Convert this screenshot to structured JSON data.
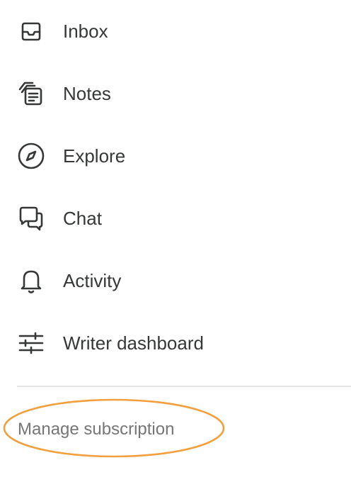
{
  "menu": {
    "items": [
      {
        "label": "Inbox",
        "icon": "inbox-icon"
      },
      {
        "label": "Notes",
        "icon": "notes-icon"
      },
      {
        "label": "Explore",
        "icon": "compass-icon"
      },
      {
        "label": "Chat",
        "icon": "chat-bubbles-icon"
      },
      {
        "label": "Activity",
        "icon": "bell-icon"
      },
      {
        "label": "Writer dashboard",
        "icon": "sliders-icon"
      }
    ]
  },
  "footer": {
    "manage_label": "Manage subscription"
  },
  "colors": {
    "text": "#363737",
    "muted_text": "#767676",
    "divider": "#e6e6e6",
    "highlight_outline": "#f2a03d"
  }
}
